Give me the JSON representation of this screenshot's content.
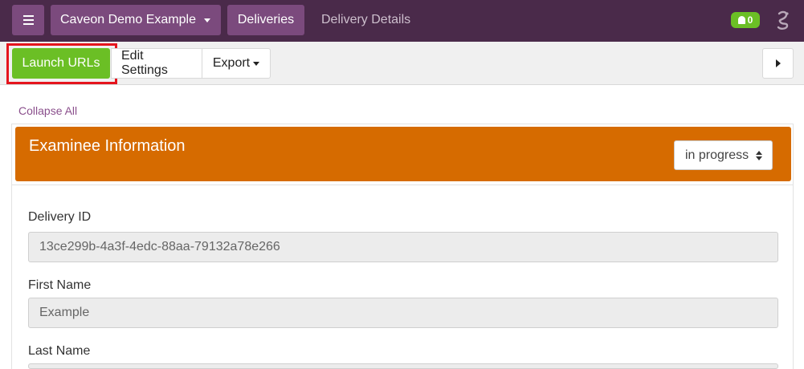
{
  "nav": {
    "org_label": "Caveon Demo Example",
    "deliveries_label": "Deliveries",
    "breadcrumb_current": "Delivery Details",
    "notification_count": "0"
  },
  "toolbar": {
    "launch_label": "Launch URLs",
    "edit_label": "Edit Settings",
    "export_label": "Export"
  },
  "content": {
    "collapse_label": "Collapse All",
    "section_title": "Examinee Information",
    "status_value": "in progress",
    "fields": [
      {
        "label": "Delivery ID",
        "value": "13ce299b-4a3f-4edc-88aa-79132a78e266"
      },
      {
        "label": "First Name",
        "value": "Example"
      },
      {
        "label": "Last Name",
        "value": ""
      }
    ]
  },
  "colors": {
    "nav_bg": "#4a2a4a",
    "nav_button": "#7b4a7d",
    "accent_green": "#6bbf25",
    "section_orange": "#d66b00",
    "link_purple": "#8a4f8c",
    "highlight_red": "#e5141d"
  }
}
